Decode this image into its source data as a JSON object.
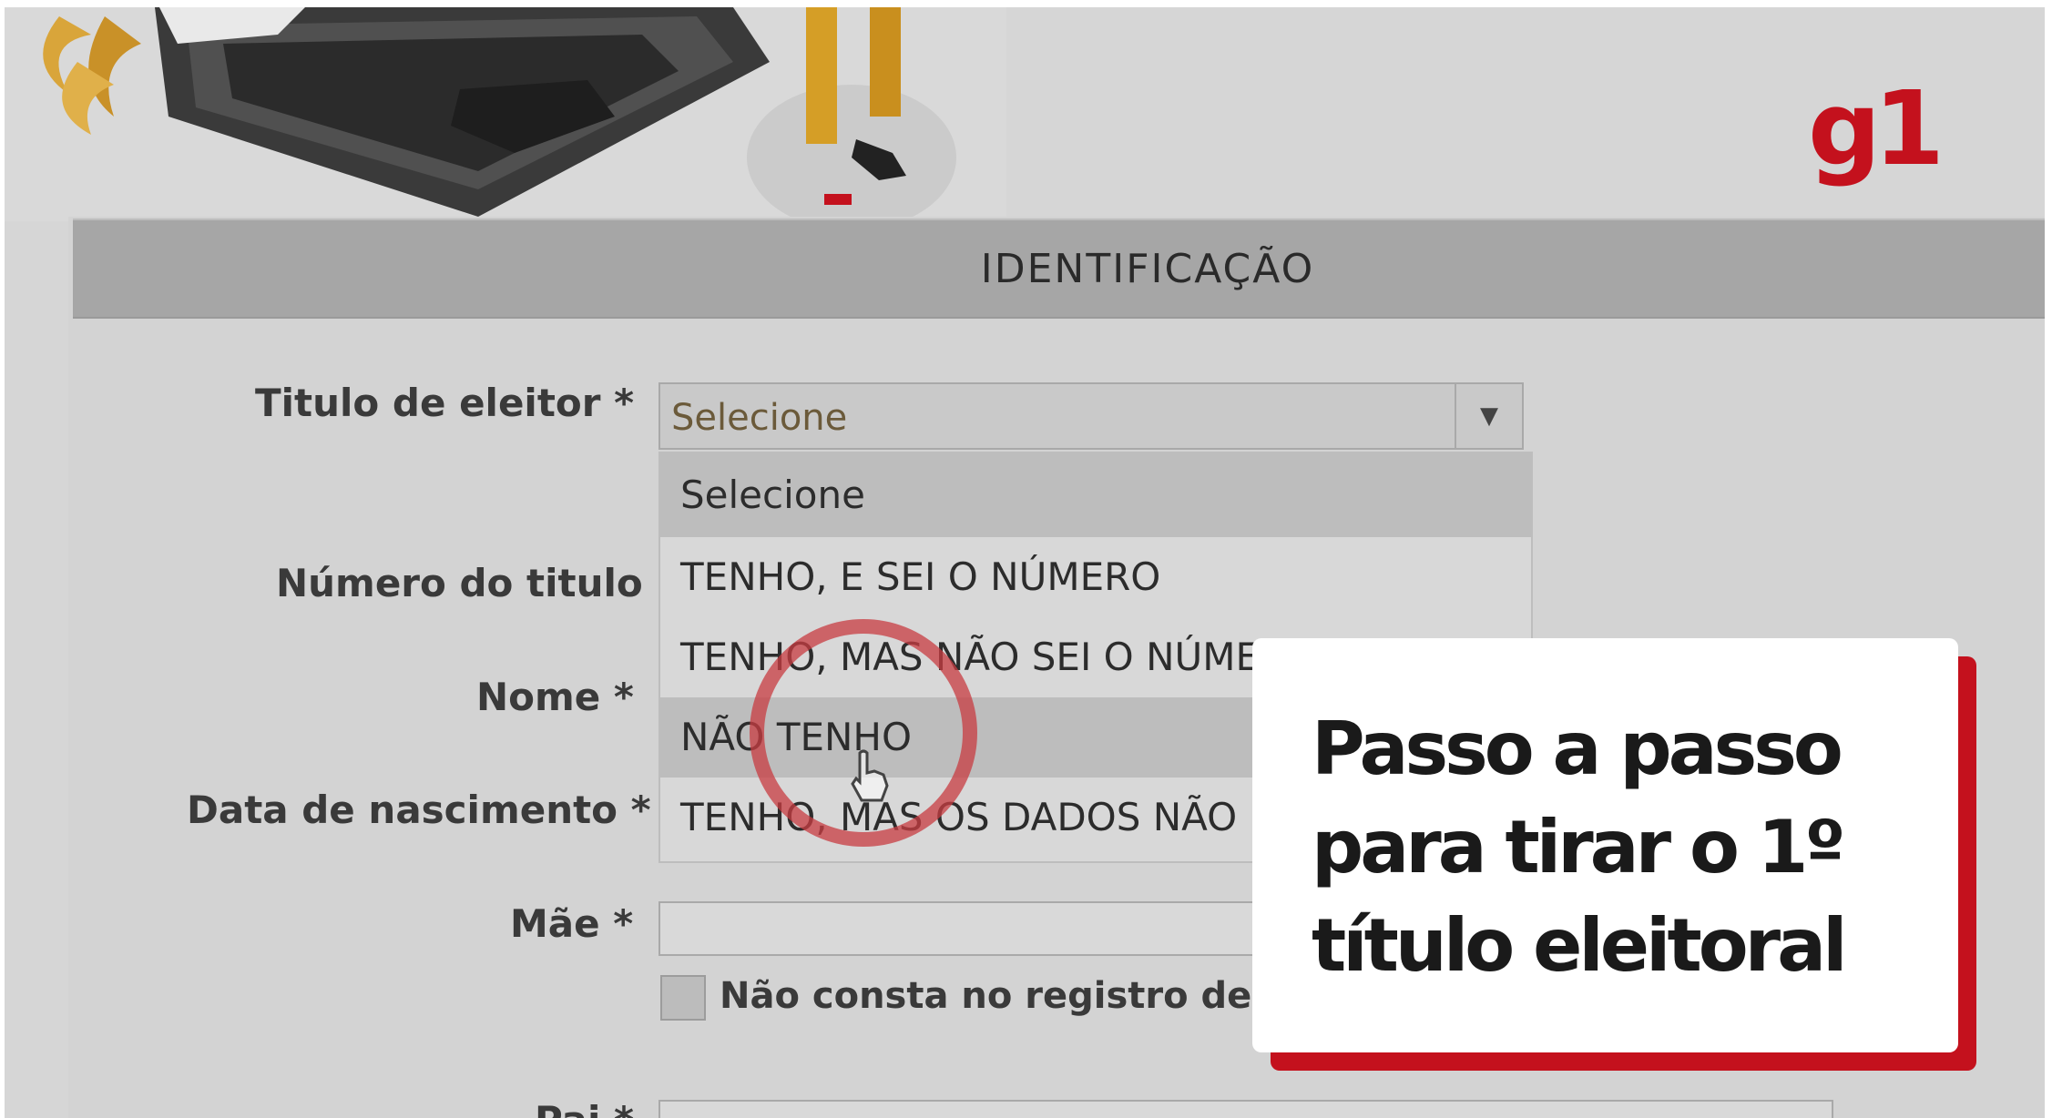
{
  "brand": {
    "logo_text": "g1",
    "logo_color": "#c4111d"
  },
  "section": {
    "title": "IDENTIFICAÇÃO"
  },
  "form": {
    "labels": {
      "titulo": "Titulo de eleitor *",
      "numero": "Número do titulo",
      "nome": "Nome *",
      "nascimento": "Data de nascimento *",
      "mae": "Mãe *",
      "pai": "Pai *"
    },
    "titulo_select": {
      "value": "Selecione",
      "options": [
        "Selecione",
        "TENHO, E SEI O NÚMERO",
        "TENHO, MAS NÃO SEI O NÚME",
        "NÃO TENHO",
        "TENHO, MAS OS DADOS NÃO"
      ],
      "highlighted_option": "NÃO TENHO"
    },
    "mae_checkbox_label": "Não consta no registro de na"
  },
  "overlay": {
    "card_text": "Passo a passo para tirar o 1º título eleitoral",
    "accent_color": "#c4111d"
  }
}
